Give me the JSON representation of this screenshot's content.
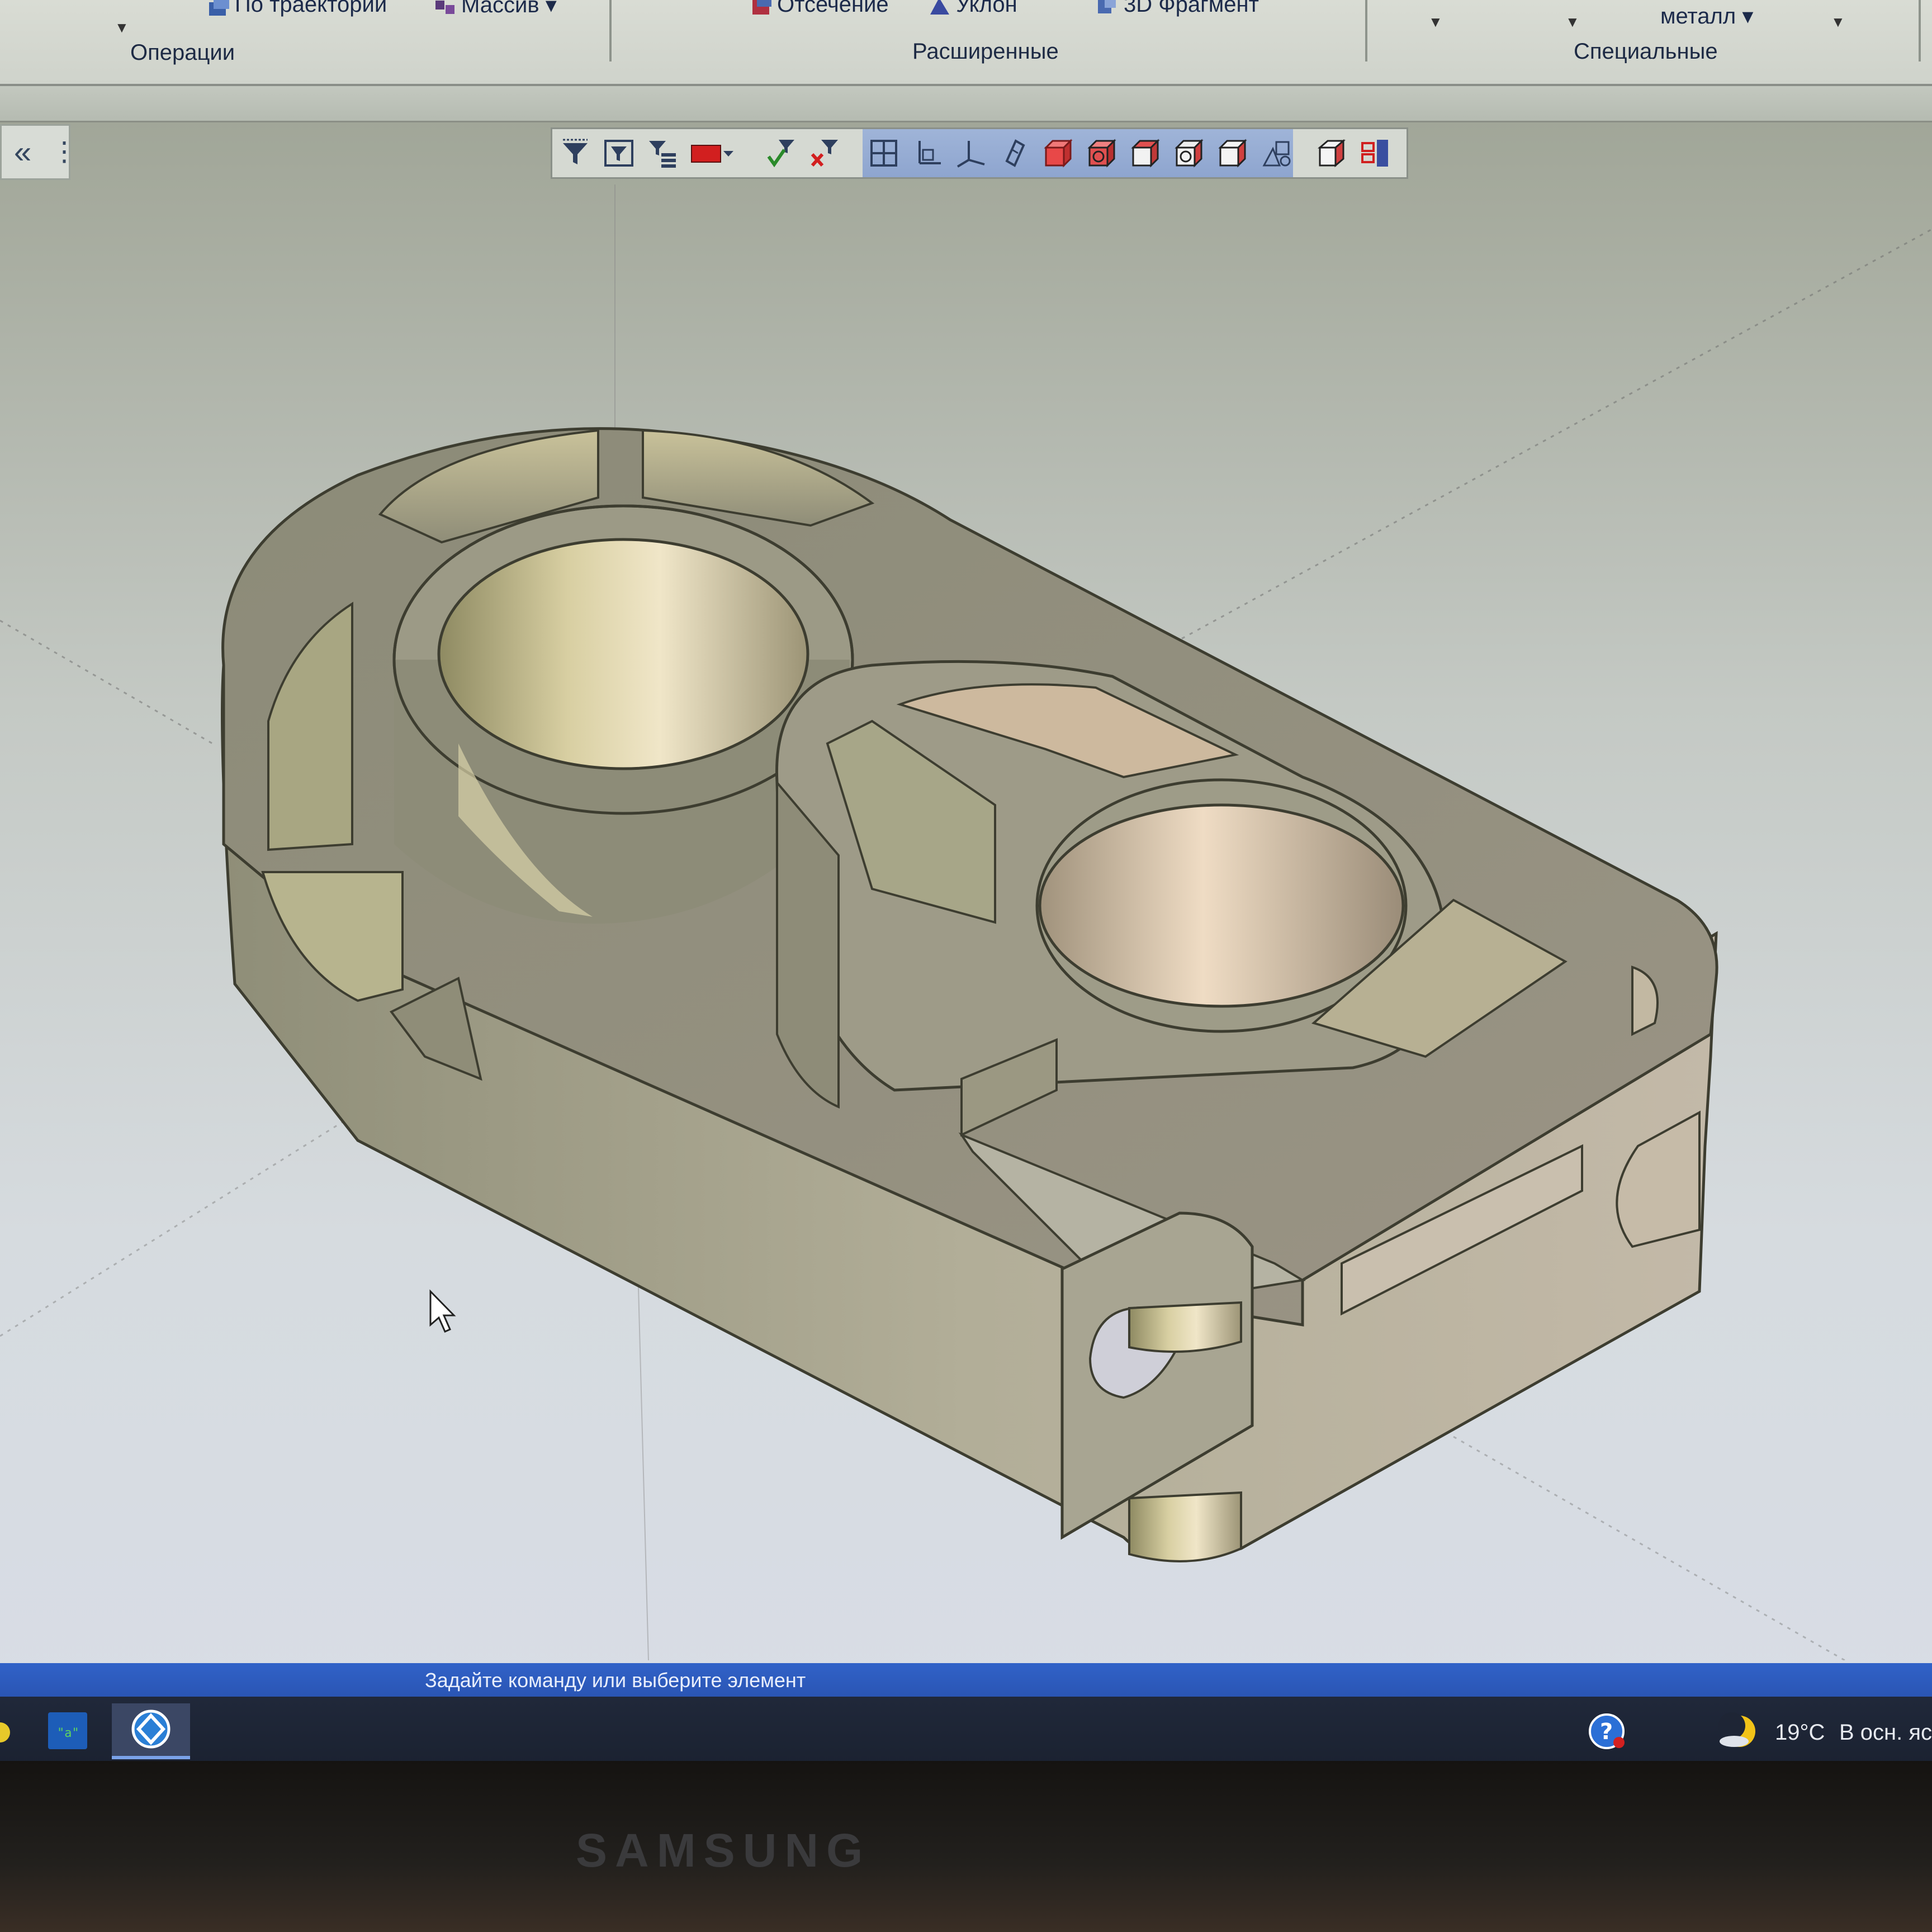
{
  "ribbon": {
    "top_items": [
      "По траектории",
      "Массив",
      "Отсечение",
      "Уклон",
      "3D Фрагмент",
      "металл"
    ],
    "groups": {
      "operations": "Операции",
      "advanced": "Расширенные",
      "special": "Специальные"
    }
  },
  "toolbar": {
    "icons": [
      "filter-icon",
      "filter-box-icon",
      "filter-tree-icon",
      "color-red-icon",
      "dropdown-arrow-icon",
      "filter-check-icon",
      "filter-cancel-icon",
      "view-grid-icon",
      "view-front-axes-icon",
      "view-iso-axes-icon",
      "orientation-icon",
      "shaded-cube-icon",
      "shaded-edges-cube-icon",
      "wireframe-cube-icon",
      "hidden-lines-cube-icon",
      "section-cube-icon",
      "perspective-icon",
      "display-mode-icon",
      "section-view-icon"
    ]
  },
  "status": {
    "prompt": "Задайте команду или выберите элемент"
  },
  "taskbar": {
    "weather_temp": "19°C",
    "weather_text": "В осн. яс"
  },
  "monitor": {
    "brand": "SAMSUNG"
  },
  "colors": {
    "status_bar": "#2f5fc4",
    "toolbar_highlight": "#94aad3",
    "model_face": "#a8a58f"
  }
}
